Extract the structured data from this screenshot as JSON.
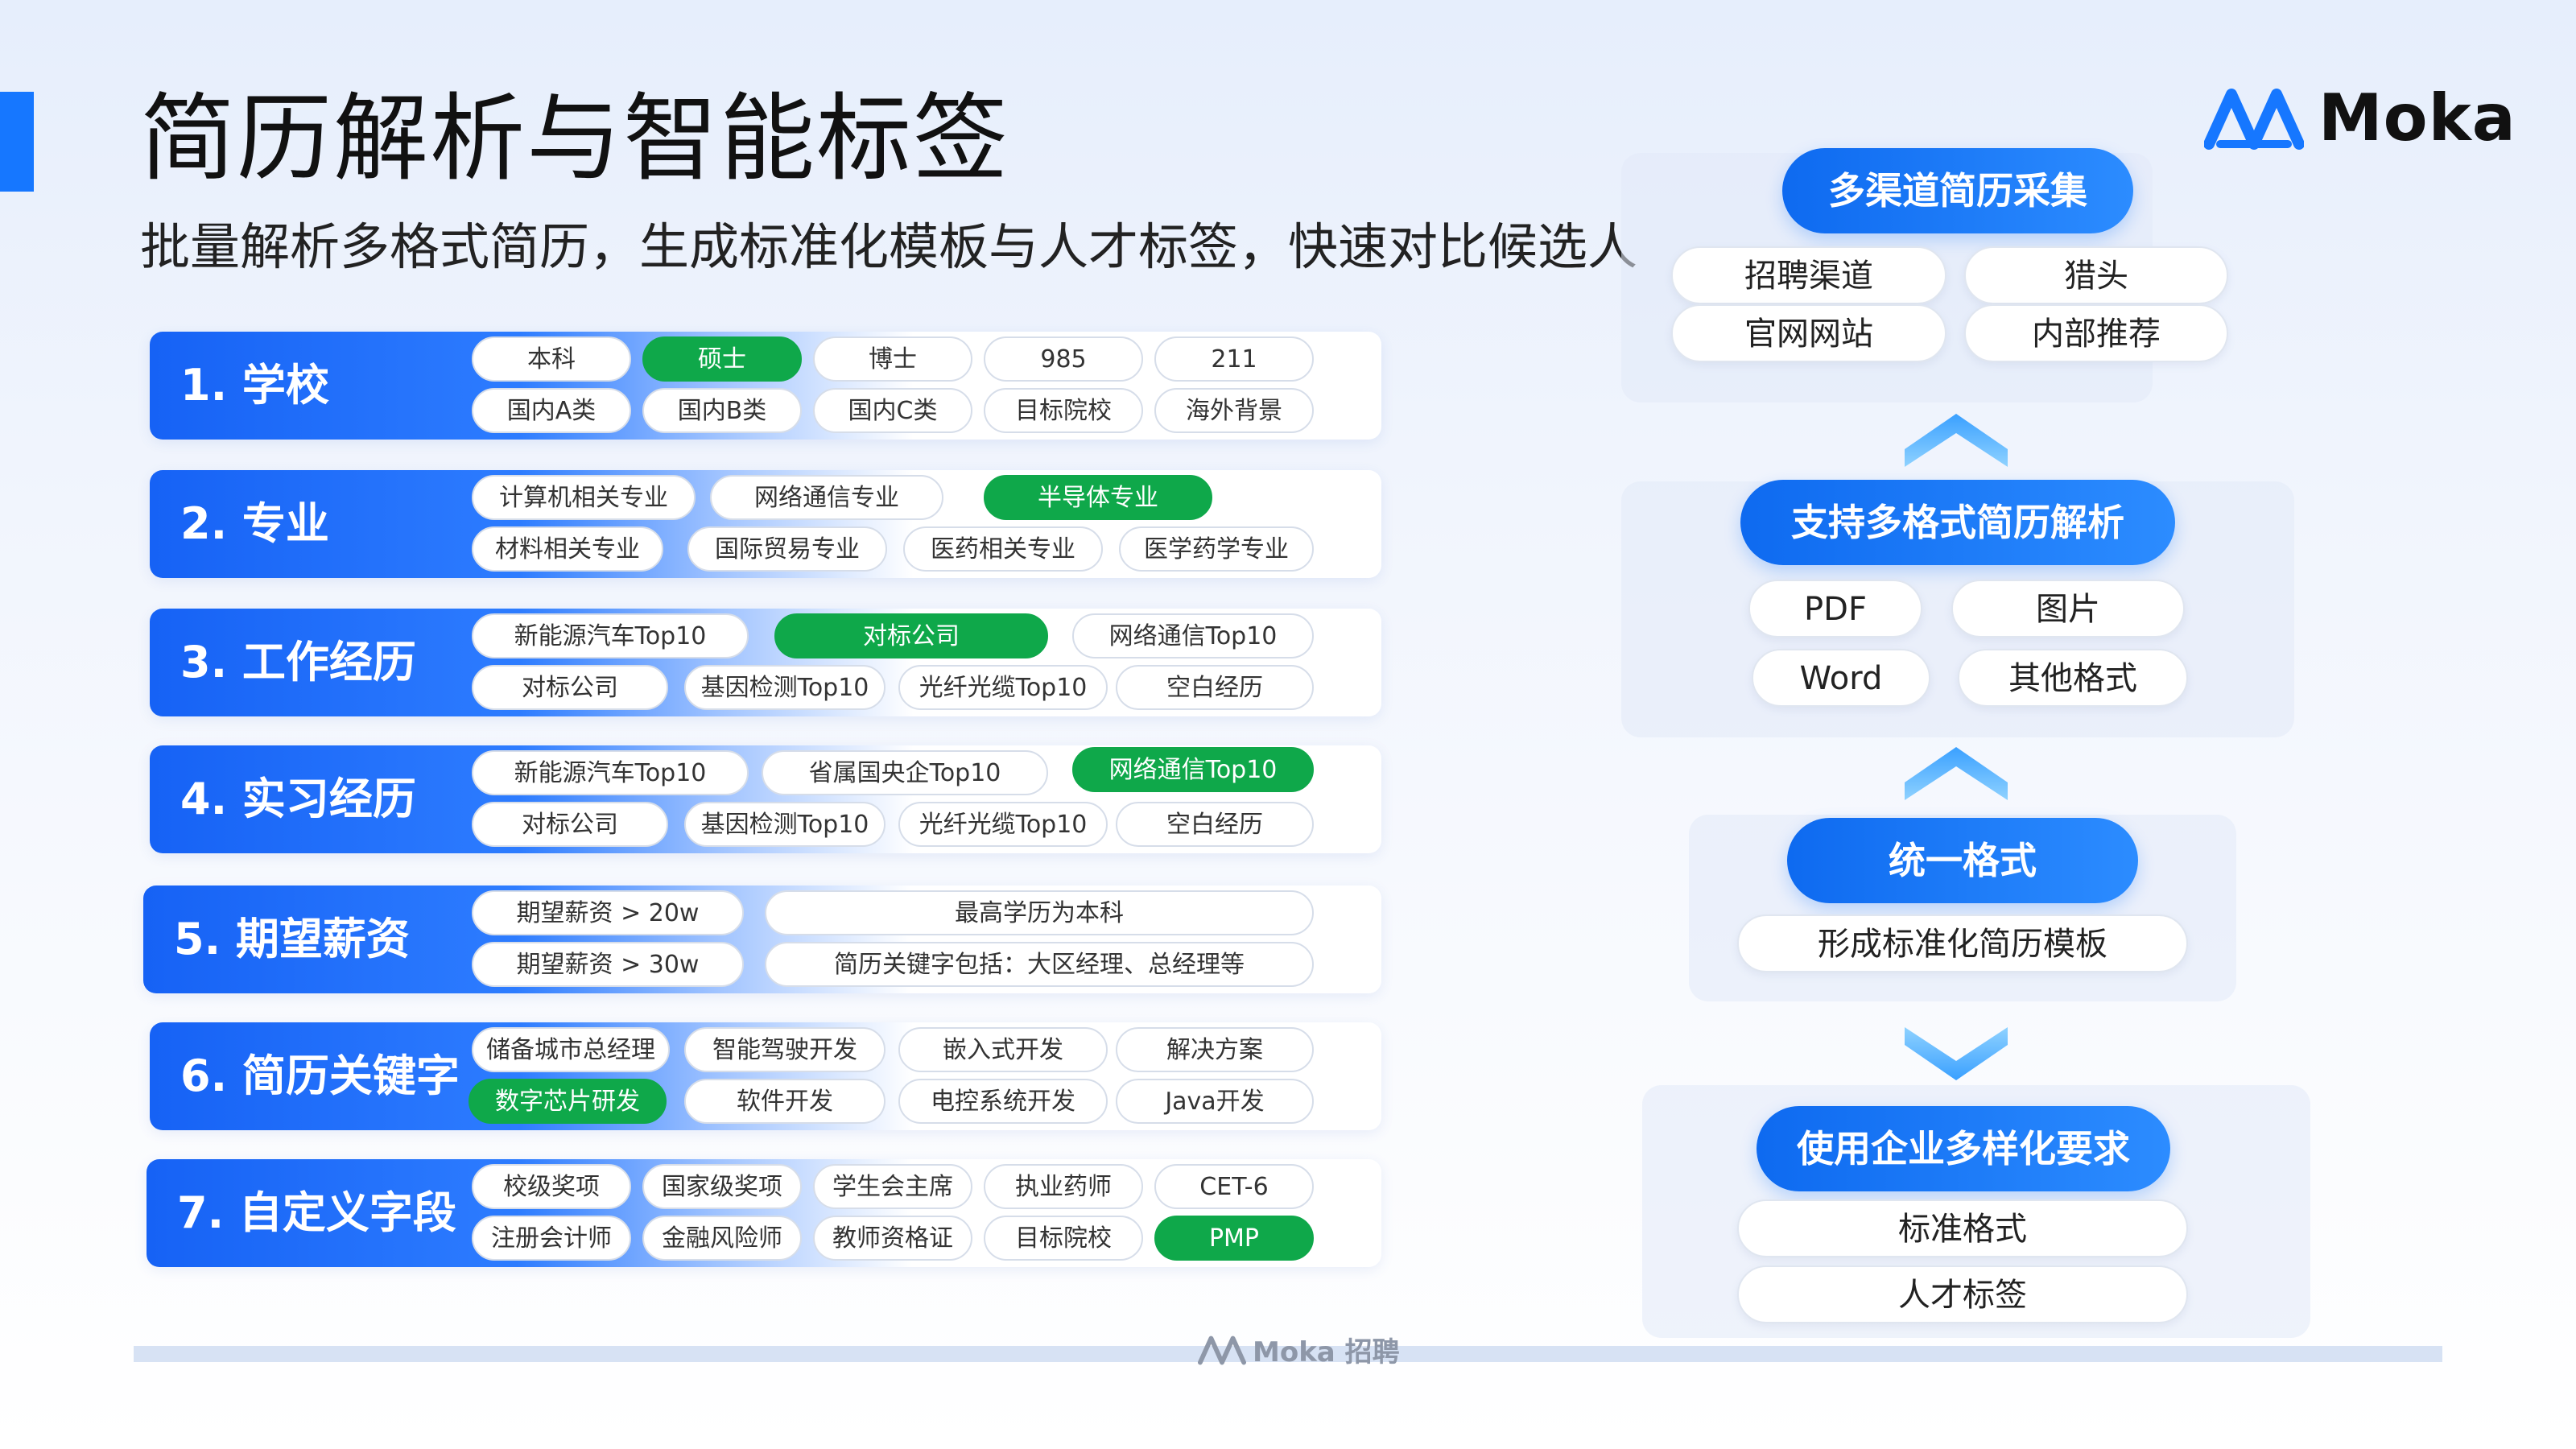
{
  "title": "简历解析与智能标签",
  "subtitle": "批量解析多格式简历，生成标准化模板与人才标签，快速对比候选人",
  "brand": {
    "name": "Moka",
    "color": "#1677ff"
  },
  "footer": {
    "brand": "Moka 招聘"
  },
  "categories": [
    {
      "label": "1. 学校",
      "tags": [
        {
          "text": "本科"
        },
        {
          "text": "硕士",
          "highlight": true
        },
        {
          "text": "博士"
        },
        {
          "text": "985"
        },
        {
          "text": "211"
        },
        {
          "text": "国内A类"
        },
        {
          "text": "国内B类"
        },
        {
          "text": "国内C类"
        },
        {
          "text": "目标院校"
        },
        {
          "text": "海外背景"
        }
      ]
    },
    {
      "label": "2. 专业",
      "tags": [
        {
          "text": "计算机相关专业"
        },
        {
          "text": "网络通信专业"
        },
        {
          "text": "半导体专业",
          "highlight": true
        },
        {
          "text": "材料相关专业"
        },
        {
          "text": "国际贸易专业"
        },
        {
          "text": "医药相关专业"
        },
        {
          "text": "医学药学专业"
        }
      ]
    },
    {
      "label": "3. 工作经历",
      "tags": [
        {
          "text": "新能源汽车Top10"
        },
        {
          "text": "对标公司",
          "highlight": true
        },
        {
          "text": "网络通信Top10"
        },
        {
          "text": "对标公司"
        },
        {
          "text": "基因检测Top10"
        },
        {
          "text": "光纤光缆Top10"
        },
        {
          "text": "空白经历"
        }
      ]
    },
    {
      "label": "4. 实习经历",
      "tags": [
        {
          "text": "新能源汽车Top10"
        },
        {
          "text": "省属国央企Top10"
        },
        {
          "text": "网络通信Top10",
          "highlight": true
        },
        {
          "text": "对标公司"
        },
        {
          "text": "基因检测Top10"
        },
        {
          "text": "光纤光缆Top10"
        },
        {
          "text": "空白经历"
        }
      ]
    },
    {
      "label": "5. 期望薪资",
      "tags": [
        {
          "text": "期望薪资 > 20w"
        },
        {
          "text": "最高学历为本科"
        },
        {
          "text": "期望薪资 > 30w"
        },
        {
          "text": "简历关键字包括：大区经理、总经理等"
        }
      ]
    },
    {
      "label": "6. 简历关键字",
      "tags": [
        {
          "text": "储备城市总经理"
        },
        {
          "text": "智能驾驶开发"
        },
        {
          "text": "嵌入式开发"
        },
        {
          "text": "解决方案"
        },
        {
          "text": "数字芯片研发",
          "highlight": true
        },
        {
          "text": "软件开发"
        },
        {
          "text": "电控系统开发"
        },
        {
          "text": "Java开发"
        }
      ]
    },
    {
      "label": "7. 自定义字段",
      "tags": [
        {
          "text": "校级奖项"
        },
        {
          "text": "国家级奖项"
        },
        {
          "text": "学生会主席"
        },
        {
          "text": "执业药师"
        },
        {
          "text": "CET-6"
        },
        {
          "text": "注册会计师"
        },
        {
          "text": "金融风险师"
        },
        {
          "text": "教师资格证"
        },
        {
          "text": "目标院校"
        },
        {
          "text": "PMP",
          "highlight": true
        }
      ]
    }
  ],
  "flow": [
    {
      "title": "多渠道简历采集",
      "options": [
        "招聘渠道",
        "猎头",
        "官网网站",
        "内部推荐"
      ]
    },
    {
      "title": "支持多格式简历解析",
      "options": [
        "PDF",
        "图片",
        "Word",
        "其他格式"
      ]
    },
    {
      "title": "统一格式",
      "options": [
        "形成标准化简历模板"
      ]
    },
    {
      "title": "使用企业多样化要求",
      "options": [
        "标准格式",
        "人才标签"
      ]
    }
  ],
  "colors": {
    "accent": "#1677ff",
    "highlight": "#0fa84a"
  },
  "icons": {
    "arrow_up": "chevron-up-icon",
    "arrow_down": "chevron-down-icon",
    "logo": "moka-logo-icon"
  }
}
